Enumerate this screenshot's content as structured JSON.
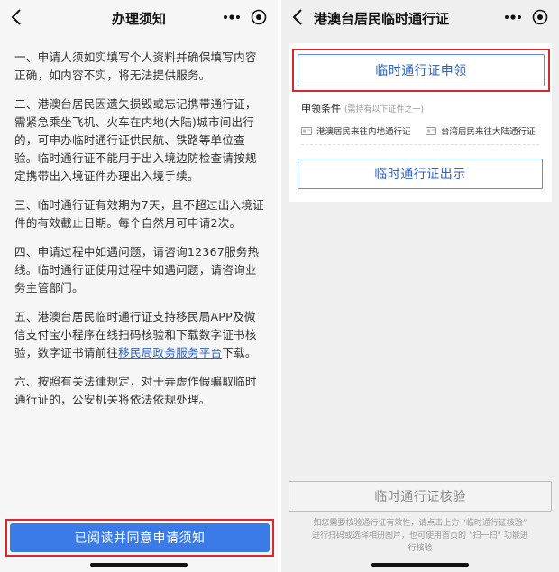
{
  "left": {
    "title": "办理须知",
    "notes": [
      "一、申请人须如实填写个人资料并确保填写内容正确，如内容不实，将无法提供服务。",
      "二、港澳台居民因遗失损毁或忘记携带通行证，需紧急乘坐飞机、火车在内地(大陆)城市间出行的，可申办临时通行证供民航、铁路等单位查验。临时通行证不能用于出入境边防检查请按规定携带出入境证件办理出入境手续。",
      "三、临时通行证有效期为7天，且不超过出入境证件的有效截止日期。每个自然月可申请2次。",
      "四、申请过程中如遇问题，请咨询12367服务热线。临时通行证使用过程中如遇问题，请咨询业务主管部门。"
    ],
    "note5_before": "五、港澳台居民临时通行证支持移民局APP及微信支付宝小程序在线扫码核验和下载数字证书核验，数字证书请前往",
    "note5_link": "移民局政务服务平台",
    "note5_after": "下载。",
    "note6": "六、按照有关法律规定，对于弄虚作假骗取临时通行证的，公安机关将依法依规处理。",
    "agree_label": "已阅读并同意申请须知"
  },
  "right": {
    "title": "港澳台居民临时通行证",
    "apply_label": "临时通行证申领",
    "conditions_label": "申领条件",
    "conditions_note": "(需持有以下证件之一)",
    "cert1": "港澳居民来往内地通行证",
    "cert2": "台湾居民来往大陆通行证",
    "show_label": "临时通行证出示",
    "verify_label": "临时通行证核验",
    "hint": "如您需要核验通行证有效性，请点击上方 “临时通行证核验” 进行扫码或选择相册图片，也可使用首页的 “扫一扫” 功能进行核验"
  },
  "colors": {
    "primary": "#3b7be8",
    "link": "#2b63c8",
    "highlight": "#d6282d"
  },
  "icons": [
    "back-arrow-icon",
    "more-dots-icon",
    "target-icon",
    "id-card-icon"
  ]
}
